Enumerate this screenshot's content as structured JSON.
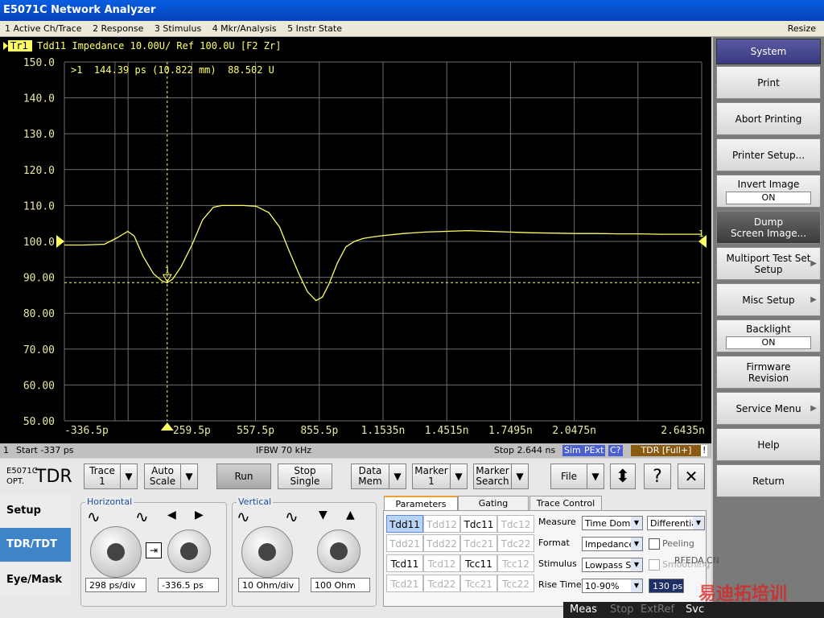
{
  "window": {
    "title": "E5071C Network Analyzer"
  },
  "menu": [
    "1 Active Ch/Trace",
    "2 Response",
    "3 Stimulus",
    "4 Mkr/Analysis",
    "5 Instr State"
  ],
  "menu_right": "Resize",
  "trace": {
    "label": "Tr1",
    "header": "Tdd11 Impedance 10.00U/ Ref 100.0U [F2 Zr]",
    "marker_readout": ">1  144.39 ps (10.822 mm)  88.502 U",
    "marker_id": "1",
    "ref_marker": "1"
  },
  "chart_data": {
    "type": "line",
    "ylim": [
      50,
      150
    ],
    "yticks": [
      "150.0",
      "140.0",
      "130.0",
      "120.0",
      "110.0",
      "100.0",
      "90.00",
      "80.00",
      "70.00",
      "60.00",
      "50.00"
    ],
    "xticks": [
      "-336.5p",
      "259.5p",
      "557.5p",
      "855.5p",
      "1.1535n",
      "1.4515n",
      "1.7495n",
      "2.0475n",
      "2.6435n"
    ],
    "x_start_ps": -336.5,
    "x_stop_ps": 2643.5,
    "marker": {
      "x_ps": 144.39,
      "y": 88.502
    },
    "series": [
      {
        "color": "#ffff66",
        "x": [
          -336.5,
          -250,
          -150,
          -90,
          -40,
          -10,
          30,
          80,
          120,
          144,
          170,
          210,
          260,
          310,
          360,
          400,
          440,
          500,
          560,
          620,
          670,
          710,
          760,
          800,
          840,
          870,
          900,
          940,
          980,
          1020,
          1060,
          1100,
          1150,
          1250,
          1350,
          1450,
          1550,
          1650,
          1750,
          1850,
          1950,
          2050,
          2150,
          2250,
          2350,
          2450,
          2550,
          2643.5
        ],
        "values": [
          99,
          99,
          99.2,
          101,
          102.8,
          101.5,
          96,
          91,
          89,
          88.5,
          89.5,
          93,
          99,
          106,
          109.5,
          110,
          110,
          110,
          109.8,
          108,
          104,
          98,
          91,
          86,
          83.5,
          84.5,
          88,
          94,
          98.5,
          100,
          100.8,
          101.2,
          101.6,
          102.2,
          102.6,
          102.8,
          103,
          102.8,
          102.6,
          102.4,
          102.3,
          102.2,
          102.2,
          102.1,
          102.1,
          102,
          102,
          102
        ]
      }
    ]
  },
  "statusbar": {
    "ch": "1",
    "start": "Start -337 ps",
    "ifbw": "IFBW 70 kHz",
    "stop": "Stop 2.644 ns",
    "sim": "Sim",
    "pext": "PExt",
    "c": "C?",
    "tdr": "TDR [Full+]",
    "bang": "!"
  },
  "softkeys": {
    "header": "System",
    "items": [
      {
        "label": "Print"
      },
      {
        "label": "Abort Printing"
      },
      {
        "label": "Printer Setup..."
      },
      {
        "label": "Invert Image",
        "value": "ON"
      },
      {
        "label": "Dump",
        "label2": "Screen Image..."
      },
      {
        "label": "Multiport Test Set",
        "label2": "Setup"
      },
      {
        "label": "Misc Setup"
      },
      {
        "label": "Backlight",
        "value": "ON"
      },
      {
        "label": "Firmware",
        "label2": "Revision"
      },
      {
        "label": "Service Menu"
      },
      {
        "label": "Help"
      },
      {
        "label": "Return"
      }
    ]
  },
  "tdr": {
    "model": "E5071C",
    "opt": "OPT.",
    "tdr": "TDR",
    "trace_btn": "Trace",
    "trace_val": "1",
    "auto_scale": "Auto",
    "auto_scale2": "Scale",
    "run": "Run",
    "stop": "Stop",
    "single": "Single",
    "data_mem": "Data",
    "data_mem2": "Mem",
    "marker": "Marker",
    "marker_val": "1",
    "marker_search": "Marker",
    "marker_search2": "Search",
    "file": "File",
    "help": "?",
    "close": "✕",
    "tabs": [
      "Setup",
      "TDR/TDT",
      "Eye/Mask"
    ],
    "horizontal": "Horizontal",
    "vertical": "Vertical",
    "h_scale": "298 ps/div",
    "h_pos": "-336.5 ps",
    "v_scale": "10 Ohm/div",
    "v_ref": "100 Ohm",
    "ptabs": [
      "Parameters",
      "Gating",
      "Trace Control"
    ],
    "params": [
      [
        "Tdd11",
        "Tdd12",
        "Tdc11",
        "Tdc12"
      ],
      [
        "Tdd21",
        "Tdd22",
        "Tdc21",
        "Tdc22"
      ],
      [
        "Tcd11",
        "Tcd12",
        "Tcc11",
        "Tcc12"
      ],
      [
        "Tcd21",
        "Tcd22",
        "Tcc21",
        "Tcc22"
      ]
    ],
    "measure_label": "Measure",
    "measure_val": "Time Doma",
    "measure_val2": "Differentia",
    "format_label": "Format",
    "format_val": "Impedance",
    "peeling": "Peeling",
    "stimulus_label": "Stimulus",
    "stimulus_val": "Lowpass St",
    "smoothing": "Smoothing",
    "rise_label": "Rise Time",
    "rise_val": "10-90%",
    "rise_ps": "130 ps"
  },
  "bottom_status": [
    "Meas",
    "Stop",
    "ExtRef",
    "Svc"
  ],
  "watermark": {
    "text": "RFEDA.CN",
    "text2": "易迪拓培训"
  },
  "colors": {
    "trace": "#ffff66",
    "plot_bg": "#000000",
    "grid": "#6e6e6e",
    "axis_text": "#e8e8a0"
  }
}
